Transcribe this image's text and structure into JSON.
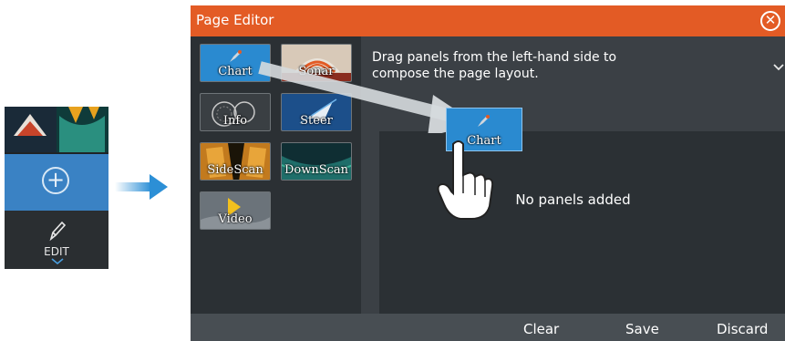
{
  "side_panel": {
    "edit_label": "EDIT"
  },
  "dialog": {
    "title": "Page Editor",
    "instruction": "Drag panels from the left-hand side to compose the page layout.",
    "empty_message": "No panels added",
    "dragged_panel_label": "Chart",
    "panels": [
      {
        "label": "Chart",
        "icon": "chart-icon"
      },
      {
        "label": "Sonar",
        "icon": "sonar-icon"
      },
      {
        "label": "Info",
        "icon": "info-gauge-icon"
      },
      {
        "label": "Steer",
        "icon": "steer-icon"
      },
      {
        "label": "SideScan",
        "icon": "sidescan-icon"
      },
      {
        "label": "DownScan",
        "icon": "downscan-icon"
      },
      {
        "label": "Video",
        "icon": "video-icon"
      }
    ],
    "buttons": {
      "clear": "Clear",
      "save": "Save",
      "discard": "Discard"
    },
    "colors": {
      "titlebar": "#e35b25",
      "accent_border": "#f29a1c",
      "chart_blue": "#2a8ad0"
    }
  }
}
